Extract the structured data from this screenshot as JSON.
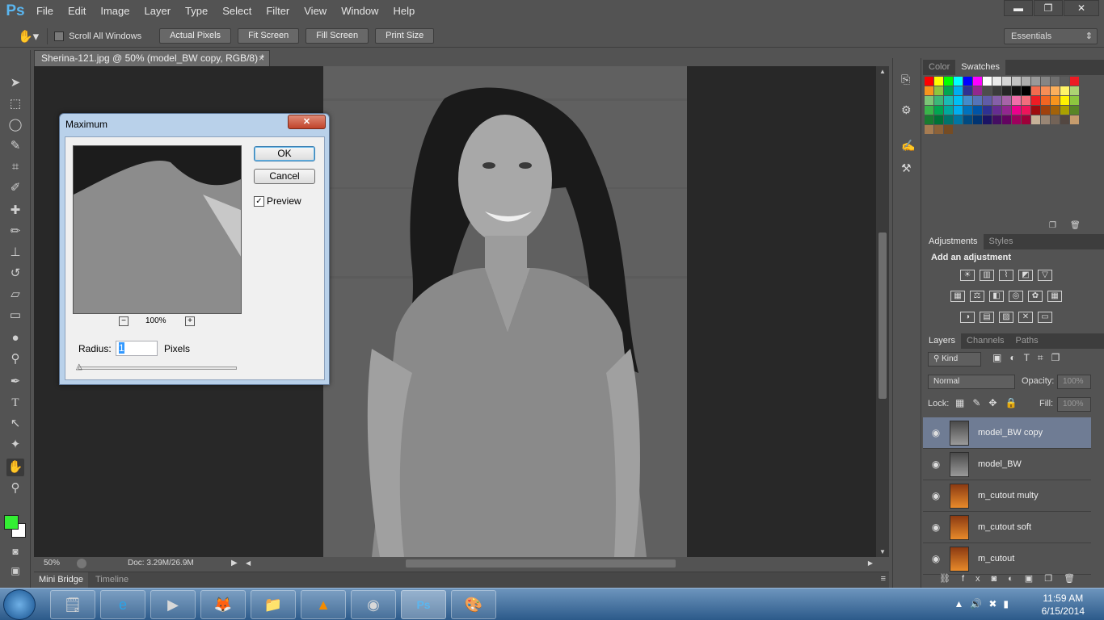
{
  "app": {
    "logo": "Ps"
  },
  "menu": [
    "File",
    "Edit",
    "Image",
    "Layer",
    "Type",
    "Select",
    "Filter",
    "View",
    "Window",
    "Help"
  ],
  "window_controls": {
    "minimize": "▬",
    "restore": "❐",
    "close": "✕"
  },
  "options_bar": {
    "scroll_all_windows": "Scroll All Windows",
    "buttons": [
      "Actual Pixels",
      "Fit Screen",
      "Fill Screen",
      "Print Size"
    ],
    "workspace": "Essentials"
  },
  "document": {
    "tab_title": "Sherina-121.jpg @ 50% (model_BW copy, RGB/8) *",
    "zoom": "50%",
    "doc_info": "Doc: 3.29M/26.9M"
  },
  "bottom_tabs": [
    "Mini Bridge",
    "Timeline"
  ],
  "tools": [
    "move-icon",
    "marquee-icon",
    "lasso-icon",
    "quick-select-icon",
    "crop-icon",
    "eyedropper-icon",
    "healing-icon",
    "brush-icon",
    "stamp-icon",
    "history-brush-icon",
    "eraser-icon",
    "gradient-icon",
    "blur-icon",
    "dodge-icon",
    "pen-icon",
    "type-icon",
    "path-select-icon",
    "shape-icon",
    "hand-icon",
    "zoom-icon"
  ],
  "colors": {
    "foreground": "#33ee33",
    "background": "#ffffff",
    "accent_selected": "#6f7c94",
    "dialog_frame": "#b9d1ea"
  },
  "swatches_panel": {
    "tabs": [
      "Color",
      "Swatches"
    ]
  },
  "adjustments_panel": {
    "tabs": [
      "Adjustments",
      "Styles"
    ],
    "heading": "Add an adjustment"
  },
  "layers_panel": {
    "tabs": [
      "Layers",
      "Channels",
      "Paths"
    ],
    "kind_label": "Kind",
    "blend_mode": "Normal",
    "opacity_label": "Opacity:",
    "opacity_value": "100%",
    "lock_label": "Lock:",
    "fill_label": "Fill:",
    "fill_value": "100%",
    "layers": [
      {
        "name": "model_BW copy",
        "selected": true,
        "thumb": "bw"
      },
      {
        "name": "model_BW",
        "selected": false,
        "thumb": "bw"
      },
      {
        "name": "m_cutout multy",
        "selected": false,
        "thumb": "color"
      },
      {
        "name": "m_cutout soft",
        "selected": false,
        "thumb": "color"
      },
      {
        "name": "m_cutout",
        "selected": false,
        "thumb": "color"
      }
    ]
  },
  "dialog": {
    "title": "Maximum",
    "ok": "OK",
    "cancel": "Cancel",
    "preview_label": "Preview",
    "preview_checked": true,
    "zoom": "100%",
    "radius_label": "Radius:",
    "radius_value": "1",
    "radius_unit": "Pixels"
  },
  "taskbar": {
    "time": "11:59 AM",
    "date": "6/15/2014",
    "apps": [
      "sticky-notes-icon",
      "ie-icon",
      "media-player-icon",
      "firefox-icon",
      "explorer-icon",
      "vlc-icon",
      "chrome-icon",
      "photoshop-icon",
      "paint-icon"
    ]
  }
}
